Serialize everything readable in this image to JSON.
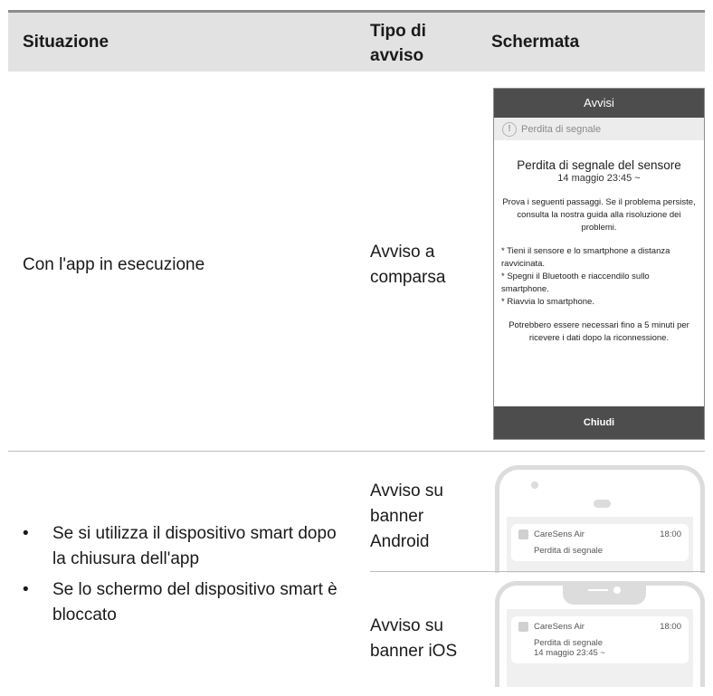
{
  "header": {
    "col1": "Situazione",
    "col2": "Tipo di avviso",
    "col3": "Schermata"
  },
  "row1": {
    "situation": "Con l'app in esecuzione",
    "type": "Avviso a comparsa",
    "popup": {
      "title": "Avvisi",
      "subtitle": "Perdita di segnale",
      "heading": "Perdita di segnale del sensore",
      "date": "14 maggio 23:45 ~",
      "text": "Prova i seguenti passaggi. Se il problema persiste, consulta la nostra guida alla risoluzione dei problemi.",
      "steps": [
        "* Tieni il sensore e lo smartphone a distanza ravvicinata.",
        "* Spegni il Bluetooth e riaccendilo sullo smartphone.",
        "* Riavvia lo smartphone."
      ],
      "note": "Potrebbero essere necessari fino a 5 minuti per ricevere i dati dopo la riconnessione.",
      "button": "Chiudi"
    }
  },
  "row2": {
    "bullets": [
      "Se si utilizza il dispositivo smart dopo la chiusura dell'app",
      "Se lo schermo del dispositivo smart è bloccato"
    ],
    "android": {
      "type": "Avviso su banner Android",
      "app": "CareSens Air",
      "time": "18:00",
      "message": "Perdita di segnale"
    },
    "ios": {
      "type": "Avviso su banner iOS",
      "app": "CareSens Air",
      "time": "18:00",
      "message": "Perdita di segnale",
      "date": "14 maggio 23:45 ~"
    }
  }
}
